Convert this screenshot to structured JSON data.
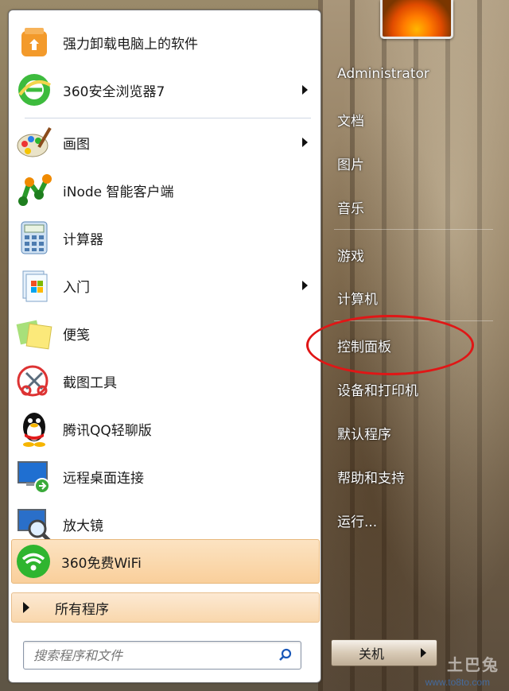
{
  "start_menu": {
    "programs": [
      {
        "label": "强力卸载电脑上的软件",
        "icon": "uninstaller-icon",
        "has_submenu": false
      },
      {
        "label": "360安全浏览器7",
        "icon": "browser-360-icon",
        "has_submenu": true
      },
      {
        "label": "画图",
        "icon": "paint-icon",
        "has_submenu": true
      },
      {
        "label": "iNode 智能客户端",
        "icon": "inode-client-icon",
        "has_submenu": false
      },
      {
        "label": "计算器",
        "icon": "calculator-icon",
        "has_submenu": false
      },
      {
        "label": "入门",
        "icon": "getting-started-icon",
        "has_submenu": true
      },
      {
        "label": "便笺",
        "icon": "sticky-notes-icon",
        "has_submenu": false
      },
      {
        "label": "截图工具",
        "icon": "snipping-tool-icon",
        "has_submenu": false
      },
      {
        "label": "腾讯QQ轻聊版",
        "icon": "qq-penguin-icon",
        "has_submenu": false
      },
      {
        "label": "远程桌面连接",
        "icon": "remote-desktop-icon",
        "has_submenu": false
      },
      {
        "label": "放大镜",
        "icon": "magnifier-icon",
        "has_submenu": false
      }
    ],
    "highlighted": {
      "label": "360免费WiFi",
      "icon": "wifi-icon"
    },
    "all_programs_label": "所有程序",
    "search": {
      "placeholder": "搜索程序和文件"
    },
    "right_links": [
      {
        "label": "Administrator"
      },
      {
        "label": "文档"
      },
      {
        "label": "图片"
      },
      {
        "label": "音乐"
      },
      {
        "label": "游戏"
      },
      {
        "label": "计算机"
      },
      {
        "label": "控制面板",
        "annotated": true
      },
      {
        "label": "设备和打印机"
      },
      {
        "label": "默认程序"
      },
      {
        "label": "帮助和支持"
      },
      {
        "label": "运行..."
      }
    ],
    "shutdown_label": "关机",
    "annotation_color": "#e01616"
  },
  "watermark": {
    "text": "土巴兔",
    "url": "www.to8to.com"
  }
}
